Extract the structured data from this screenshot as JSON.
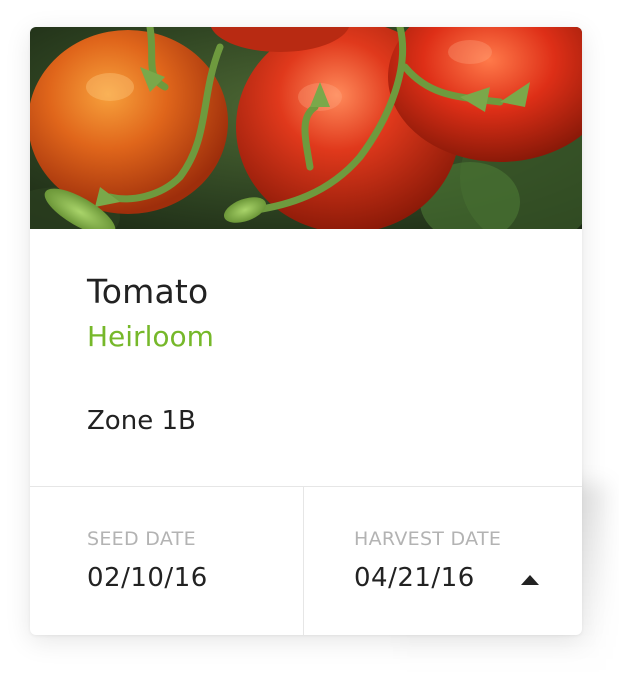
{
  "card": {
    "image_alt": "tomatoes-photo",
    "title": "Tomato",
    "variety": "Heirloom",
    "zone": "Zone 1B",
    "seed_date_label": "SEED DATE",
    "seed_date_value": "02/10/16",
    "harvest_date_label": "HARVEST DATE",
    "harvest_date_value": "04/21/16",
    "harvest_toggle_icon": "caret-up-icon"
  },
  "colors": {
    "accent": "#76b82a",
    "text_primary": "#222222",
    "text_muted": "#b3b3b3",
    "divider": "#e6e6e6"
  }
}
